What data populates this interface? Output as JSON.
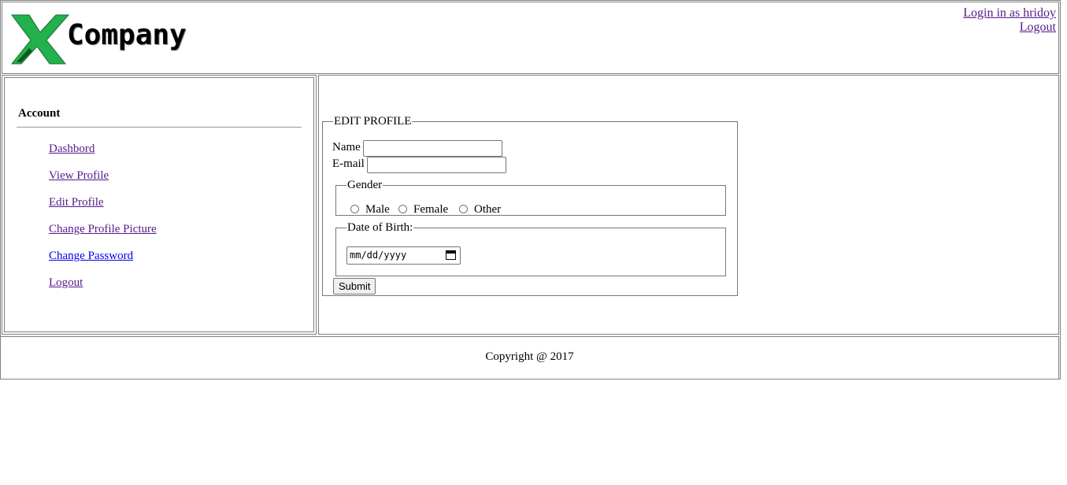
{
  "header": {
    "logo_letter": "X",
    "company_name": "Company",
    "login_label": "Login in as hridoy",
    "logout_label": "Logout"
  },
  "sidebar": {
    "title": "Account",
    "items": [
      {
        "label": "Dashbord"
      },
      {
        "label": "View Profile"
      },
      {
        "label": "Edit Profile"
      },
      {
        "label": "Change Profile Picture"
      },
      {
        "label": "Change Password"
      },
      {
        "label": "Logout"
      }
    ]
  },
  "form": {
    "legend": "EDIT PROFILE",
    "name_label": "Name",
    "name_value": "",
    "email_label": "E-mail",
    "email_value": "",
    "gender_legend": "Gender",
    "gender_options": [
      "Male",
      "Female",
      "Other"
    ],
    "dob_legend": "Date of Birth:",
    "dob_placeholder": "mm/dd/yyyy",
    "submit_label": "Submit"
  },
  "footer": {
    "copyright": "Copyright @ 2017"
  },
  "colors": {
    "logo_green": "#22b14c",
    "visited_link": "#551a8b",
    "link": "#0000ee"
  }
}
